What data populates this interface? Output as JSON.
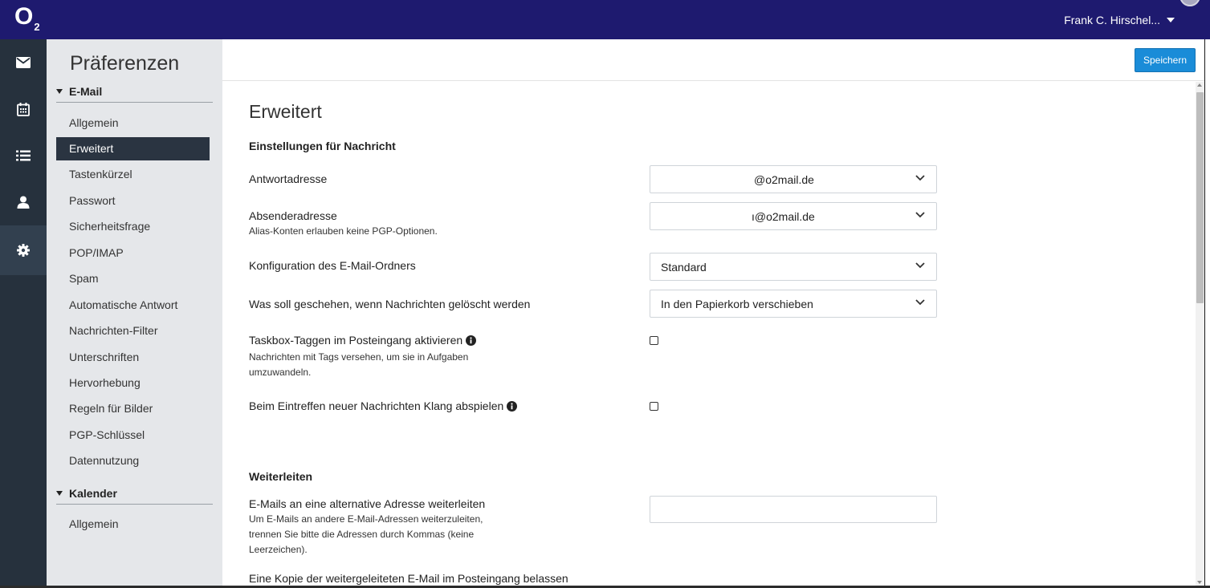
{
  "header": {
    "logo_letter": "O",
    "logo_sub": "2",
    "user_name": "Frank C. Hirschel..."
  },
  "toolbar": {
    "save_label": "Speichern"
  },
  "sidebar": {
    "title": "Präferenzen",
    "sections": [
      {
        "label": "E-Mail",
        "items": [
          "Allgemein",
          "Erweitert",
          "Tastenkürzel",
          "Passwort",
          "Sicherheitsfrage",
          "POP/IMAP",
          "Spam",
          "Automatische Antwort",
          "Nachrichten-Filter",
          "Unterschriften",
          "Hervorhebung",
          "Regeln für Bilder",
          "PGP-Schlüssel",
          "Datennutzung"
        ]
      },
      {
        "label": "Kalender",
        "items": [
          "Allgemein"
        ]
      }
    ],
    "selected_item": "Erweitert"
  },
  "icon_rail": [
    "mail-icon",
    "calendar-icon",
    "list-icon",
    "contacts-icon",
    "settings-icon"
  ],
  "main": {
    "title": "Erweitert",
    "section_message": "Einstellungen für Nachricht",
    "reply_address_label": "Antwortadresse",
    "reply_address_value": "@o2mail.de",
    "sender_address_label": "Absenderadresse",
    "sender_address_help": "Alias-Konten erlauben keine PGP-Optionen.",
    "sender_address_value": "ı@o2mail.de",
    "folder_config_label": "Konfiguration des E-Mail-Ordners",
    "folder_config_value": "Standard",
    "delete_action_label": "Was soll geschehen, wenn Nachrichten gelöscht werden",
    "delete_action_value": "In den Papierkorb verschieben",
    "taskbox_label": "Taskbox-Taggen im Posteingang aktivieren",
    "taskbox_help": "Nachrichten mit Tags versehen, um sie in Aufgaben umzuwandeln.",
    "taskbox_checked": false,
    "sound_label": "Beim Eintreffen neuer Nachrichten Klang abspielen",
    "sound_checked": false,
    "section_forward": "Weiterleiten",
    "forward_label": "E-Mails an eine alternative Adresse weiterleiten",
    "forward_help": "Um E-Mails an andere E-Mail-Adressen weiterzuleiten, trennen Sie bitte die Adressen durch Kommas (keine Leerzeichen).",
    "forward_value": "",
    "keep_copy_label": "Eine Kopie der weitergeleiteten E-Mail im Posteingang belassen"
  },
  "colors": {
    "header_bg": "#1e1a6f",
    "rail_bg": "#26313d",
    "sidebar_bg": "#e5e7ea",
    "selected_bg": "#2a3441",
    "primary_button": "#1a8cd8"
  }
}
